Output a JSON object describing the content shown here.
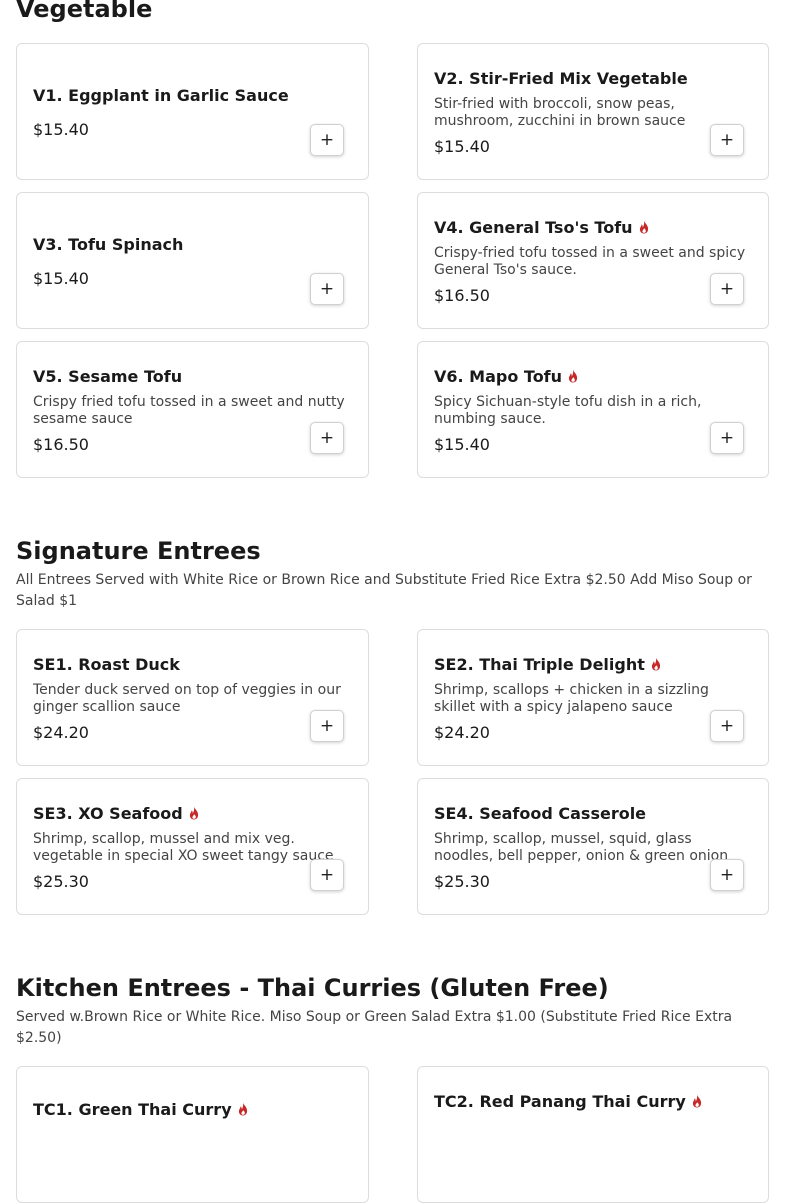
{
  "colors": {
    "accent": "#c62828",
    "card_border": "#dddddd"
  },
  "sections": [
    {
      "title": "Vegetable",
      "subtitle": "",
      "items": [
        {
          "name": "V1. Eggplant in Garlic Sauce",
          "spicy": false,
          "description": "",
          "price": "$15.40",
          "add_label": "+"
        },
        {
          "name": "V2. Stir-Fried Mix Vegetable",
          "spicy": false,
          "description": "Stir-fried with broccoli, snow peas, mushroom, zucchini in brown sauce",
          "price": "$15.40",
          "add_label": "+"
        },
        {
          "name": "V3. Tofu Spinach",
          "spicy": false,
          "description": "",
          "price": "$15.40",
          "add_label": "+"
        },
        {
          "name": "V4. General Tso's Tofu",
          "spicy": true,
          "description": "Crispy-fried tofu tossed in a sweet and spicy General Tso's sauce.",
          "price": "$16.50",
          "add_label": "+"
        },
        {
          "name": "V5. Sesame Tofu",
          "spicy": false,
          "description": "Crispy fried tofu tossed in a sweet and nutty sesame sauce",
          "price": "$16.50",
          "add_label": "+"
        },
        {
          "name": "V6. Mapo Tofu",
          "spicy": true,
          "description": "Spicy Sichuan-style tofu dish in a rich, numbing sauce.",
          "price": "$15.40",
          "add_label": "+"
        }
      ]
    },
    {
      "title": "Signature Entrees",
      "subtitle": "All Entrees Served with White Rice or Brown Rice and Substitute Fried Rice Extra $2.50 Add Miso Soup or Salad $1",
      "items": [
        {
          "name": "SE1. Roast Duck",
          "spicy": false,
          "description": "Tender duck served on top of veggies in our ginger scallion sauce",
          "price": "$24.20",
          "add_label": "+"
        },
        {
          "name": "SE2. Thai Triple Delight",
          "spicy": true,
          "description": "Shrimp, scallops + chicken in a sizzling skillet with a spicy jalapeno sauce",
          "price": "$24.20",
          "add_label": "+"
        },
        {
          "name": "SE3. XO Seafood",
          "spicy": true,
          "description": "Shrimp, scallop, mussel and mix veg. vegetable in special XO sweet tangy sauce",
          "price": "$25.30",
          "add_label": "+"
        },
        {
          "name": "SE4. Seafood Casserole",
          "spicy": false,
          "description": "Shrimp, scallop, mussel, squid, glass noodles, bell pepper, onion & green onion",
          "price": "$25.30",
          "add_label": "+"
        }
      ]
    },
    {
      "title": "Kitchen Entrees - Thai Curries (Gluten Free)",
      "subtitle": "Served w.Brown Rice or White Rice. Miso Soup or Green Salad Extra $1.00 (Substitute Fried Rice Extra $2.50)",
      "items": [
        {
          "name": "TC1. Green Thai Curry",
          "spicy": true,
          "description": "",
          "price": "",
          "add_label": "+"
        },
        {
          "name": "TC2. Red Panang Thai Curry",
          "spicy": true,
          "description": "",
          "price": "",
          "add_label": "+"
        }
      ]
    }
  ]
}
